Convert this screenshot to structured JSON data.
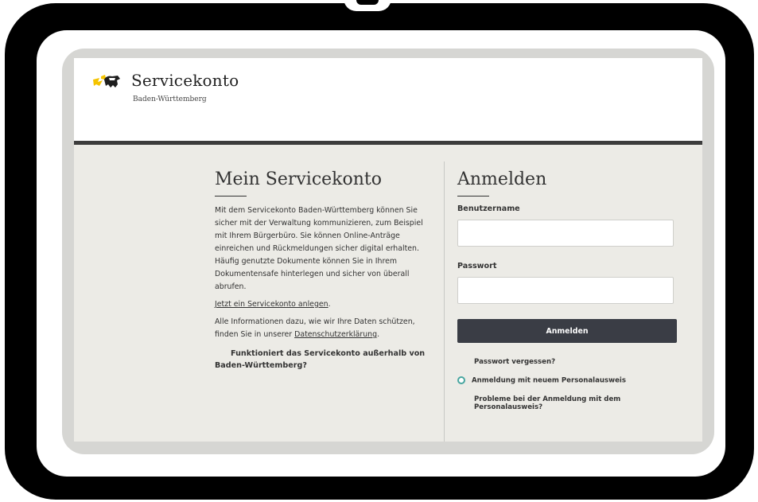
{
  "header": {
    "brand_name": "Servicekonto",
    "brand_subtitle": "Baden-Württemberg",
    "logo_icon": "lion-state-logo-icon",
    "accent_color": "#f5c400",
    "bar_color": "#3c3c3c"
  },
  "info": {
    "title": "Mein Servicekonto",
    "description": "Mit dem Servicekonto Baden-Württemberg können Sie sicher mit der Verwaltung kommunizieren, zum Beispiel mit Ihrem Bürgerbüro. Sie können Online-Anträge einreichen und Rückmeldungen sicher digital erhalten. Häufig genutzte Dokumente können Sie in Ihrem Dokumentensafe hinterlegen und sicher von überall abrufen.",
    "create_account_link": "Jetzt ein Servicekonto anlegen",
    "create_account_suffix": ".",
    "privacy_text": "Alle Informationen dazu, wie wir Ihre Daten schützen, finden Sie in unserer ",
    "privacy_link": "Datenschutzerklärung",
    "privacy_suffix": ".",
    "question_line1": "Funktioniert das Servicekonto außerhalb von",
    "question_line2": "Baden-Württemberg?"
  },
  "login": {
    "title": "Anmelden",
    "username_label": "Benutzername",
    "username_value": "",
    "password_label": "Passwort",
    "password_value": "",
    "submit_label": "Anmelden",
    "submit_color": "#3a3d45",
    "forgot_password": "Passwort vergessen?",
    "eid_login": "Anmeldung mit neuem Personalausweis",
    "eid_icon": "id-card-circle-icon",
    "eid_problems": "Probleme bei der Anmeldung mit dem Personalausweis?"
  }
}
